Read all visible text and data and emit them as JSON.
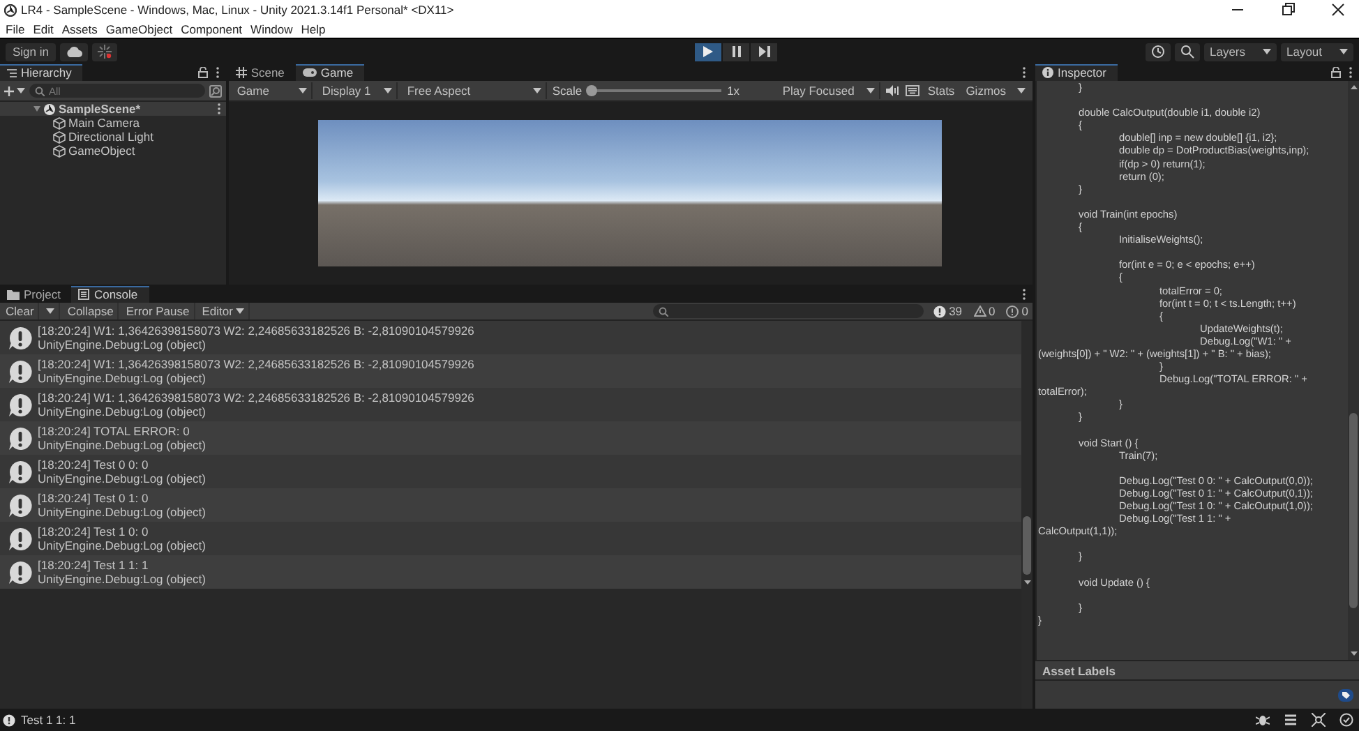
{
  "window": {
    "title": "LR4 - SampleScene - Windows, Mac, Linux - Unity 2021.3.14f1 Personal* <DX11>"
  },
  "menu": [
    "File",
    "Edit",
    "Assets",
    "GameObject",
    "Component",
    "Window",
    "Help"
  ],
  "toolbar": {
    "sign_in": "Sign in",
    "playing": true,
    "paused": false,
    "layers": "Layers",
    "layout": "Layout"
  },
  "hierarchy": {
    "tab": {
      "label": "Hierarchy",
      "selected": true
    },
    "search": {
      "placeholder": "All"
    },
    "tree": [
      {
        "label": "SampleScene*",
        "kind": "scene",
        "expanded": true,
        "children": [
          {
            "label": "Main Camera",
            "kind": "object"
          },
          {
            "label": "Directional Light",
            "kind": "object"
          },
          {
            "label": "GameObject",
            "kind": "object"
          }
        ]
      }
    ]
  },
  "game_view": {
    "tabs": [
      {
        "label": "Scene",
        "kind": "scene",
        "selected": false
      },
      {
        "label": "Game",
        "kind": "game",
        "selected": true
      }
    ],
    "toolbar": {
      "view": "Game",
      "display": "Display 1",
      "aspect": "Free Aspect",
      "scale_label": "Scale",
      "scale": {
        "level": 0
      },
      "scale_value": "1x",
      "play_mode": "Play Focused",
      "stats": "Stats",
      "gizmos": "Gizmos"
    }
  },
  "inspector": {
    "tab": {
      "label": "Inspector",
      "selected": true
    },
    "code": "\t}\n\n\tdouble CalcOutput(double i1, double i2)\n\t{\n\t\tdouble[] inp = new double[] {i1, i2};\n\t\tdouble dp = DotProductBias(weights,inp);\n\t\tif(dp > 0) return(1);\n\t\treturn (0);\n\t}\n\n\tvoid Train(int epochs)\n\t{\n\t\tInitialiseWeights();\n\n\t\tfor(int e = 0; e < epochs; e++)\n\t\t{\n\t\t\ttotalError = 0;\n\t\t\tfor(int t = 0; t < ts.Length; t++)\n\t\t\t{\n\t\t\t\tUpdateWeights(t);\n\t\t\t\tDebug.Log(\"W1: \" +\n(weights[0]) + \" W2: \" + (weights[1]) + \" B: \" + bias);\n\t\t\t}\n\t\t\tDebug.Log(\"TOTAL ERROR: \" +\ntotalError);\n\t\t}\n\t}\n\n\tvoid Start () {\n\t\tTrain(7);\n\n\t\tDebug.Log(\"Test 0 0: \" + CalcOutput(0,0));\n\t\tDebug.Log(\"Test 0 1: \" + CalcOutput(0,1));\n\t\tDebug.Log(\"Test 1 0: \" + CalcOutput(1,0));\n\t\tDebug.Log(\"Test 1 1: \" +\nCalcOutput(1,1));\n\n\t}\n\n\tvoid Update () {\n\n\t}\n}",
    "asset_labels": "Asset Labels"
  },
  "console": {
    "tabs": [
      {
        "label": "Project",
        "kind": "project",
        "selected": false
      },
      {
        "label": "Console",
        "kind": "console",
        "selected": true
      }
    ],
    "toolbar": {
      "clear": "Clear",
      "collapse": "Collapse",
      "error_pause": "Error Pause",
      "editor": "Editor"
    },
    "counts": {
      "log": "39",
      "warning": "0",
      "error": "0"
    },
    "entries": [
      {
        "message": "[18:20:24] W1: 1,36426398158073 W2: 2,24685633182526 B: -2,81090104579926",
        "source": "UnityEngine.Debug:Log (object)"
      },
      {
        "message": "[18:20:24] W1: 1,36426398158073 W2: 2,24685633182526 B: -2,81090104579926",
        "source": "UnityEngine.Debug:Log (object)"
      },
      {
        "message": "[18:20:24] W1: 1,36426398158073 W2: 2,24685633182526 B: -2,81090104579926",
        "source": "UnityEngine.Debug:Log (object)"
      },
      {
        "message": "[18:20:24] TOTAL ERROR: 0",
        "source": "UnityEngine.Debug:Log (object)"
      },
      {
        "message": "[18:20:24] Test 0 0: 0",
        "source": "UnityEngine.Debug:Log (object)"
      },
      {
        "message": "[18:20:24] Test 0 1: 0",
        "source": "UnityEngine.Debug:Log (object)"
      },
      {
        "message": "[18:20:24] Test 1 0: 0",
        "source": "UnityEngine.Debug:Log (object)"
      },
      {
        "message": "[18:20:24] Test 1 1: 1",
        "source": "UnityEngine.Debug:Log (object)"
      }
    ]
  },
  "status_bar": {
    "message": "Test 1 1: 1"
  }
}
